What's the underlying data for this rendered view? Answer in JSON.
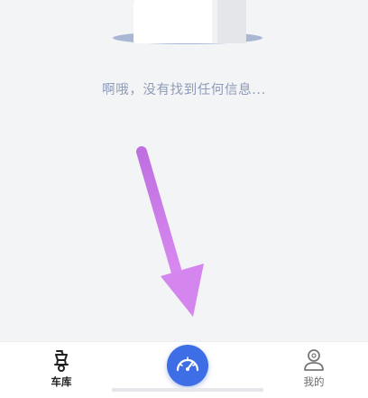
{
  "empty_state": {
    "illustration": "empty-box-illustration",
    "message": "啊哦，没有找到任何信息..."
  },
  "overlay": {
    "arrow_icon": "down-arrow-annotation",
    "arrow_color": "#cf7de8"
  },
  "tabbar": {
    "tabs": [
      {
        "label": "车库",
        "icon": "scooter-icon",
        "active": true
      },
      {
        "label": "我的",
        "icon": "profile-icon",
        "active": false
      }
    ],
    "center_button": {
      "icon": "speedometer-icon",
      "color": "#3e6ee6"
    }
  }
}
